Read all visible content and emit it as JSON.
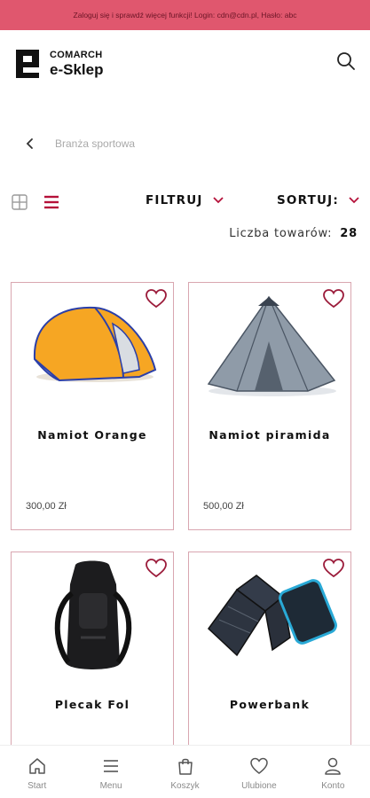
{
  "banner": {
    "text": "Zaloguj się i sprawdź więcej funkcji! Login: cdn@cdn.pl, Hasło: abc"
  },
  "header": {
    "logo_brand": "COMARCH",
    "logo_name": "e-Sklep",
    "logo_icon": "comarch-e-logo",
    "search_icon": "search-icon"
  },
  "breadcrumb": {
    "label": "Branża sportowa"
  },
  "toolbar": {
    "filter_label": "FILTRUJ",
    "sort_label": "SORTUJ:",
    "grid_view_icon": "grid-view-icon",
    "list_view_icon": "list-view-icon"
  },
  "product_count": {
    "label": "Liczba towarów:",
    "value": "28"
  },
  "products": [
    {
      "name": "Namiot Orange",
      "price": "300,00 Zł",
      "image": "orange-pop-up-tent"
    },
    {
      "name": "Namiot piramida",
      "price": "500,00 Zł",
      "image": "grey-pyramid-tent"
    },
    {
      "name": "Plecak Fol",
      "price": "",
      "image": "black-backpack"
    },
    {
      "name": "Powerbank",
      "price": "",
      "image": "solar-powerbank"
    }
  ],
  "bottom_nav": [
    {
      "label": "Start",
      "icon": "home-icon"
    },
    {
      "label": "Menu",
      "icon": "menu-icon"
    },
    {
      "label": "Koszyk",
      "icon": "cart-icon"
    },
    {
      "label": "Ulubione",
      "icon": "heart-icon"
    },
    {
      "label": "Konto",
      "icon": "user-icon"
    }
  ],
  "colors": {
    "accent": "#b5113a",
    "banner_bg": "#e0576e",
    "card_border": "#d9a6b0",
    "heart": "#9b1b3a"
  }
}
